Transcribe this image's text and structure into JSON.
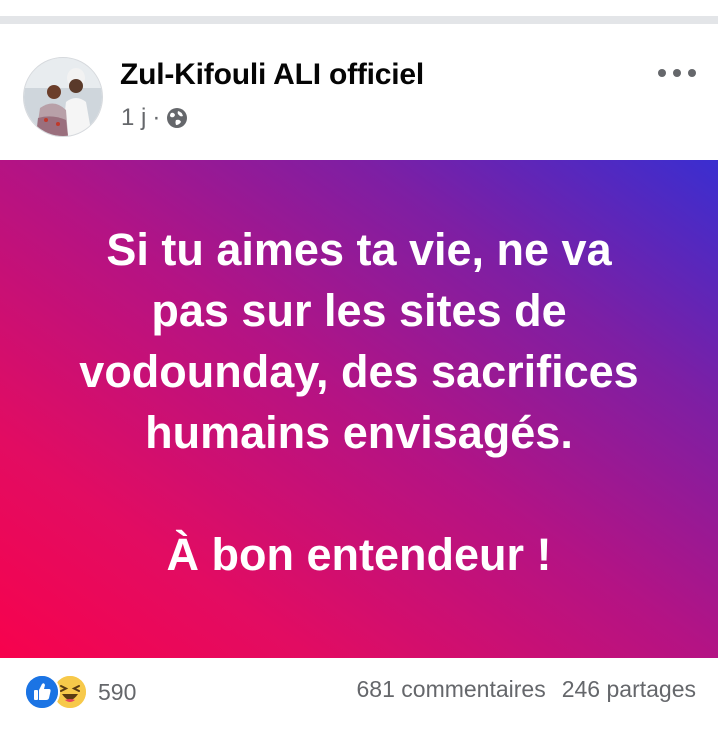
{
  "post": {
    "author": "Zul-Kifouli ALI officiel",
    "time": "1 j",
    "separator": "·",
    "audience_icon": "globe-icon",
    "more_icon": "more-options-icon",
    "background_colors": [
      "#f7024d",
      "#b41384",
      "#3a2ed0"
    ],
    "text_lines": [
      "Si tu aimes ta vie, ne va",
      "pas sur les sites de",
      "vodounday, des sacrifices",
      "humains envisagés."
    ],
    "text_closing": "À bon entendeur !"
  },
  "footer": {
    "reaction_icons": [
      "like-icon",
      "haha-icon"
    ],
    "reaction_count": "590",
    "comments": "681 commentaires",
    "shares": "246 partages"
  }
}
